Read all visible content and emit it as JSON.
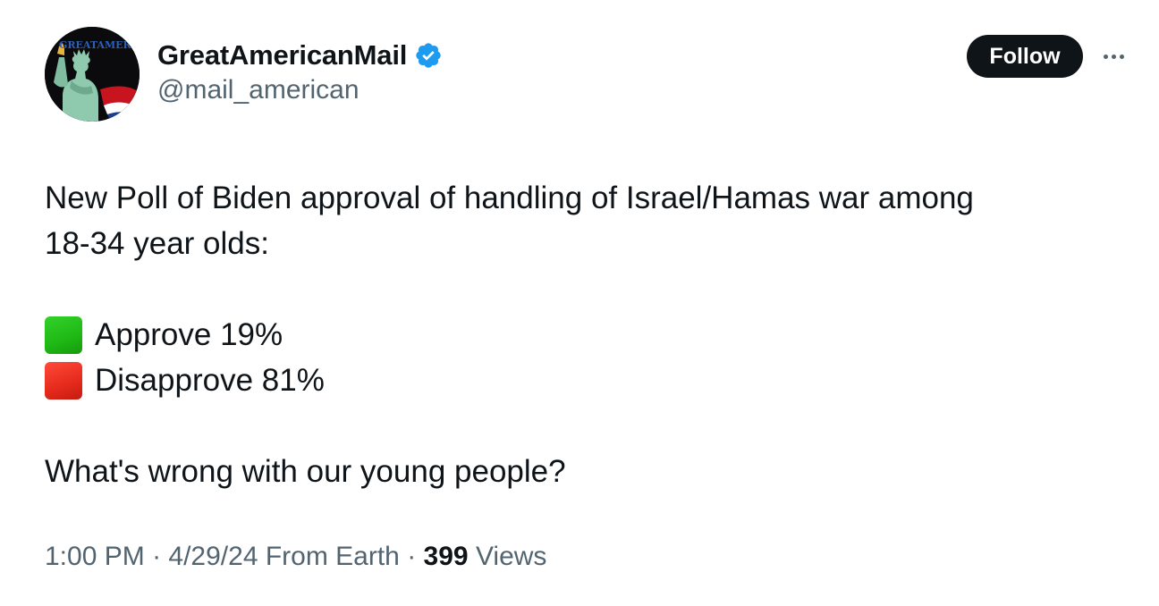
{
  "author": {
    "avatar_text": "GREATAMERICA",
    "display_name": "GreatAmericanMail",
    "handle": "@mail_american",
    "verified_icon": "verified-badge-icon",
    "verified_color": "#1d9bf0"
  },
  "actions": {
    "follow_label": "Follow",
    "more_icon": "more-horizontal-icon"
  },
  "tweet": {
    "line1": "New Poll of Biden approval of handling of Israel/Hamas war among",
    "line2": "18-34 year olds:",
    "options": [
      {
        "icon": "green-square-icon",
        "color": "#1fb814",
        "text": "Approve 19%"
      },
      {
        "icon": "red-square-icon",
        "color": "#e52a1c",
        "text": "Disapprove 81%"
      }
    ],
    "closing": "What's wrong with our young people?"
  },
  "meta": {
    "time": "1:00 PM",
    "sep1": " · ",
    "date": "4/29/24",
    "source": " From Earth",
    "sep2": " · ",
    "views_count": "399",
    "views_label": " Views"
  },
  "colors": {
    "text_primary": "#0f1419",
    "text_secondary": "#536471",
    "button_bg": "#0f1419"
  }
}
